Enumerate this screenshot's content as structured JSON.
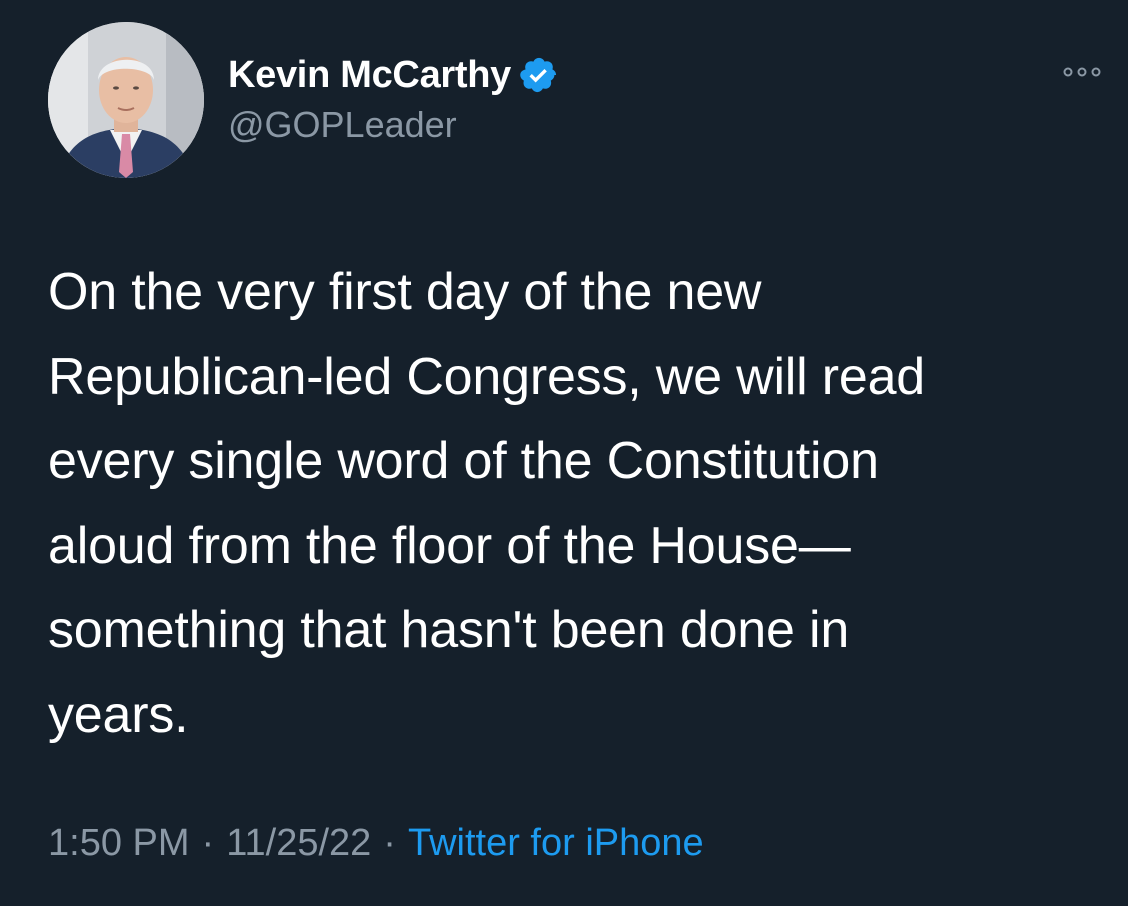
{
  "author": {
    "display_name": "Kevin McCarthy",
    "handle": "@GOPLeader",
    "verified": true,
    "verified_badge_color": "#1d9bf0"
  },
  "tweet": {
    "text": "On the very first day of the new\nRepublican-led Congress, we will read\nevery single word of the Constitution\naloud from the floor of the House—\nsomething that hasn't been done in\nyears."
  },
  "meta": {
    "time": "1:50 PM",
    "date": "11/25/22",
    "source": "Twitter for iPhone",
    "separator": "·"
  },
  "icons": {
    "verified": "verified-badge-icon",
    "more": "more-options-icon"
  },
  "theme": {
    "background": "#15202b",
    "text": "#ffffff",
    "muted": "#8b98a5",
    "link": "#1d9bf0"
  }
}
